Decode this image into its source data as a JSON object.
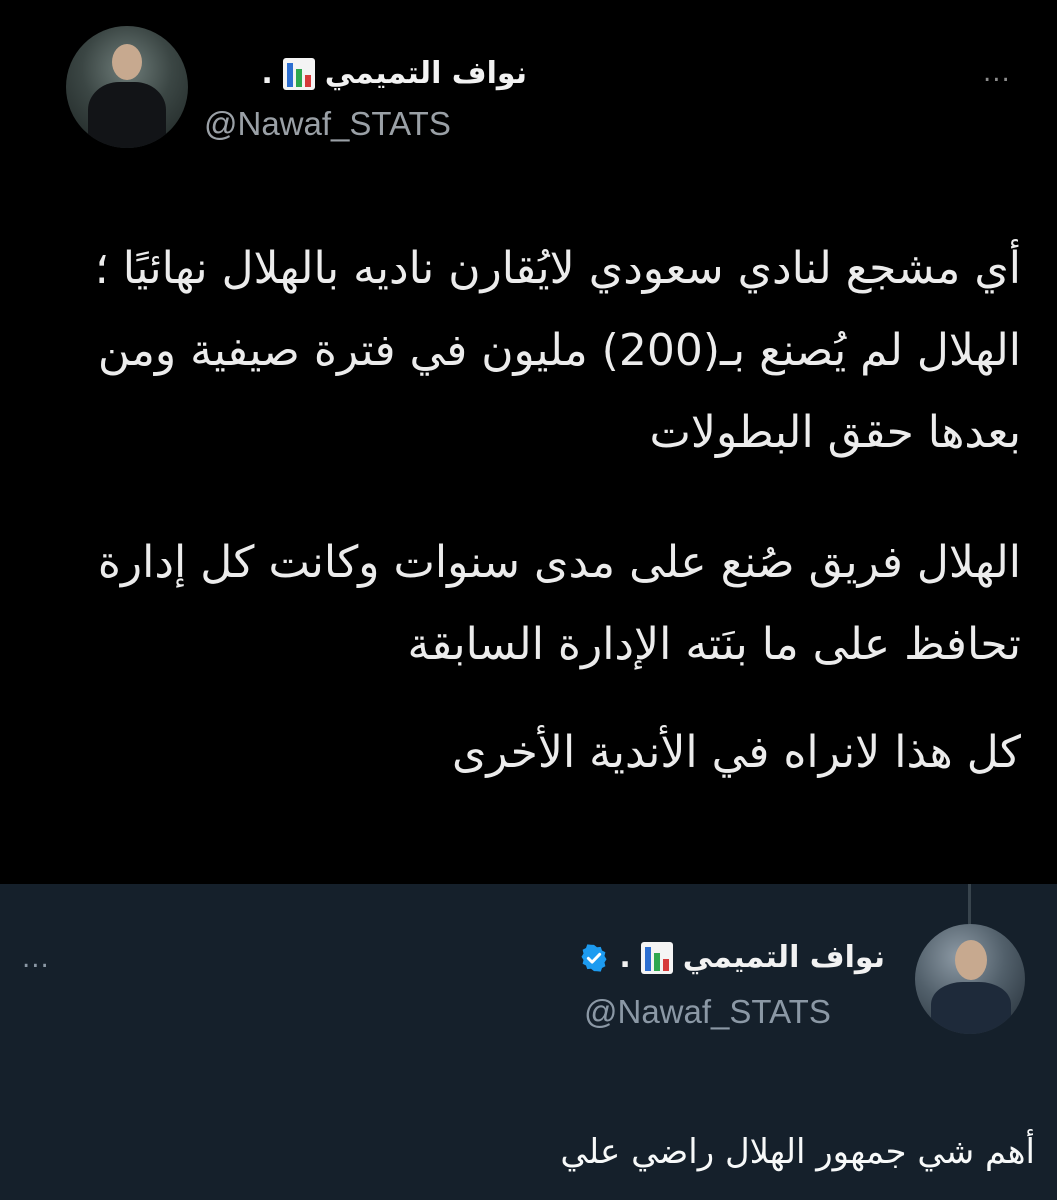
{
  "original_tweet": {
    "display_name": "نواف التميمي",
    "separator": ".",
    "handle": "@Nawaf_STATS",
    "more_label": "...",
    "paragraphs": [
      "أي مشجع لنادي سعودي لايُقارن ناديه بالهلال نهائيًا ؛ الهلال لم يُصنع بـ(200) مليون في فترة صيفية ومن بعدها حقق البطولات",
      "الهلال فريق صُنع على مدى سنوات وكانت كل إدارة تحافظ على ما بنَته الإدارة السابقة",
      "كل هذا لانراه في الأندية الأخرى"
    ]
  },
  "reply_tweet": {
    "display_name": "نواف التميمي",
    "separator": ".",
    "handle": "@Nawaf_STATS",
    "more_label": "...",
    "text": "أهم شي جمهور الهلال راضي علي",
    "verified_color": "#1d9bf0"
  },
  "colors": {
    "top_background": "#000000",
    "bottom_background": "#15202b",
    "stats_bar_red": "#d63b3b",
    "stats_bar_green": "#2fa84f",
    "stats_bar_blue": "#2d6fd1"
  },
  "icons": [
    "stats-chart-icon",
    "more-icon",
    "verified-badge-icon",
    "avatar"
  ]
}
